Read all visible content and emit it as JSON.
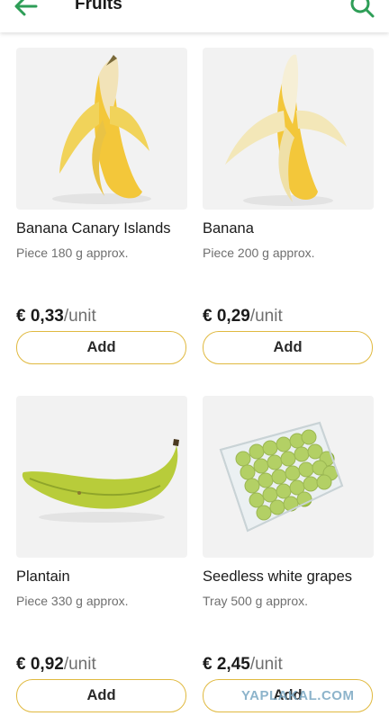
{
  "header": {
    "title": "Fruits",
    "back_icon": "arrow-left-icon",
    "search_icon": "search-icon",
    "accent": "#2e9e57"
  },
  "products": [
    {
      "name": "Banana Canary Islands",
      "weight": "Piece 180 g approx.",
      "price": "€ 0,33",
      "unit": "/unit",
      "add_label": "Add",
      "image": "peeled-banana-image"
    },
    {
      "name": "Banana",
      "weight": "Piece 200 g approx.",
      "price": "€ 0,29",
      "unit": "/unit",
      "add_label": "Add",
      "image": "peeled-banana-image"
    },
    {
      "name": "Plantain",
      "weight": "Piece 330 g approx.",
      "price": "€ 0,92",
      "unit": "/unit",
      "add_label": "Add",
      "image": "plantain-image"
    },
    {
      "name": "Seedless white grapes",
      "weight": "Tray 500 g approx.",
      "price": "€ 2,45",
      "unit": "/unit",
      "add_label": "Add",
      "image": "grapes-tray-image"
    }
  ],
  "watermark": "YAPLAKAL.COM",
  "colors": {
    "button_border": "#e0b93f",
    "image_bg": "#f2f2f2",
    "secondary_text": "#6f6f6f"
  }
}
